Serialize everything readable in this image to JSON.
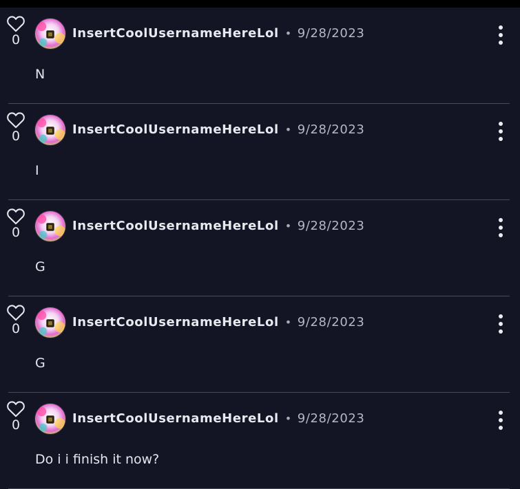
{
  "comments": [
    {
      "likes": "0",
      "username": "InsertCoolUsernameHereLol",
      "date": "9/28/2023",
      "text": "N"
    },
    {
      "likes": "0",
      "username": "InsertCoolUsernameHereLol",
      "date": "9/28/2023",
      "text": "I"
    },
    {
      "likes": "0",
      "username": "InsertCoolUsernameHereLol",
      "date": "9/28/2023",
      "text": "G"
    },
    {
      "likes": "0",
      "username": "InsertCoolUsernameHereLol",
      "date": "9/28/2023",
      "text": "G"
    },
    {
      "likes": "0",
      "username": "InsertCoolUsernameHereLol",
      "date": "9/28/2023",
      "text": "Do i i finish it now?"
    }
  ],
  "separator": "•",
  "icons": {
    "like": "heart-icon",
    "menu": "kebab-menu-icon",
    "avatar": "avatar-image"
  },
  "colors": {
    "background": "#131424",
    "text": "#e6e6ee",
    "muted": "#b6b8c4",
    "divider": "#4a4b5a"
  }
}
